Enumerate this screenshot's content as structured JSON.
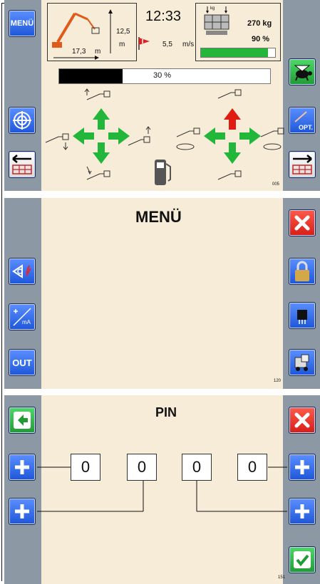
{
  "screen_main": {
    "menu_label": "MENÜ",
    "time": "12:33",
    "reach_value": "17,3",
    "reach_unit": "m",
    "height_value": "12,5",
    "height_unit": "m",
    "wind_value": "5,5",
    "wind_unit": "m/s",
    "load_kg_small": "kg",
    "load_value": "270 kg",
    "load_percent": "90 %",
    "load_fraction": 0.9,
    "progress_fraction": 0.3,
    "progress_label": "30 %",
    "opt_label": "OPT.",
    "screen_code": "005",
    "colors": {
      "accent_green": "#22b63b",
      "arrow_red": "#e01b12",
      "progress_black": "#000000"
    }
  },
  "screen_menu": {
    "title": "MENÜ",
    "out_label": "OUT",
    "screen_code": "120"
  },
  "screen_pin": {
    "title": "PIN",
    "digits": [
      "0",
      "0",
      "0",
      "0"
    ],
    "screen_code": "151"
  },
  "icons": {
    "menu": "menu-button",
    "target": "target-icon",
    "back_table": "arrow-left-table-icon",
    "turtle": "turtle-speed-icon",
    "forward_table": "arrow-right-table-icon",
    "close": "close-x-icon",
    "lock": "padlock-icon",
    "chip": "chip-icon",
    "vehicle": "vehicle-icon",
    "sensor": "sensor-icon",
    "calibration": "calibration-ma-icon",
    "back_green": "arrow-left-green-icon",
    "plus": "plus-icon",
    "check": "check-icon",
    "fuel": "fuel-pump-icon"
  }
}
